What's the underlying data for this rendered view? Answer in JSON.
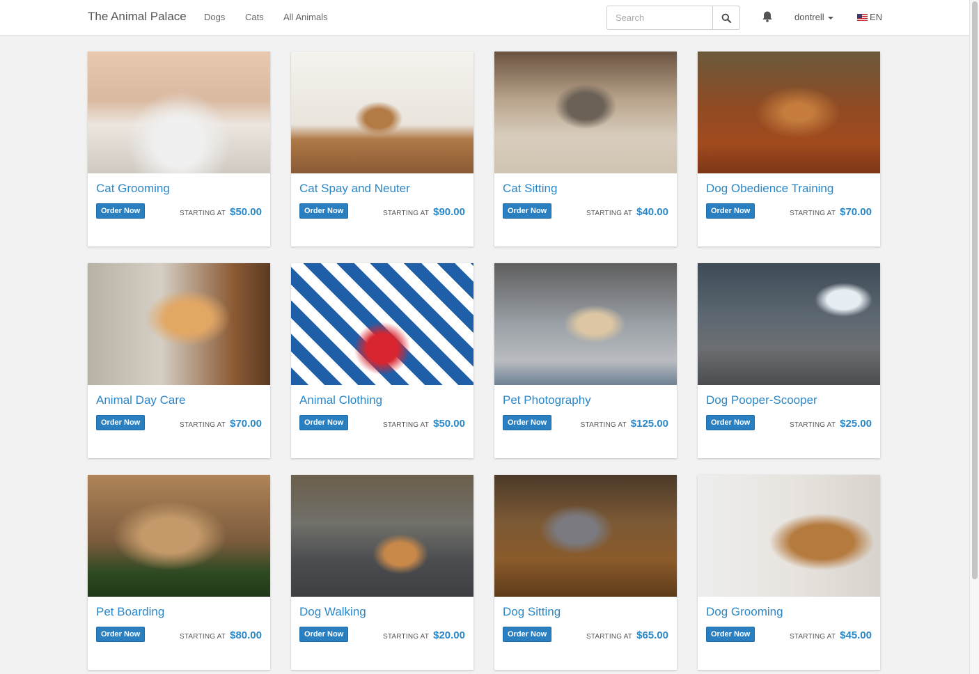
{
  "navbar": {
    "brand": "The Animal Palace",
    "links": [
      "Dogs",
      "Cats",
      "All Animals"
    ],
    "search_placeholder": "Search",
    "user": "dontrell",
    "language": "EN"
  },
  "cards": [
    {
      "title": "Cat Grooming",
      "button": "Order Now",
      "starting_label": "STARTING AT",
      "price": "$50.00"
    },
    {
      "title": "Cat Spay and Neuter",
      "button": "Order Now",
      "starting_label": "STARTING AT",
      "price": "$90.00"
    },
    {
      "title": "Cat Sitting",
      "button": "Order Now",
      "starting_label": "STARTING AT",
      "price": "$40.00"
    },
    {
      "title": "Dog Obedience Training",
      "button": "Order Now",
      "starting_label": "STARTING AT",
      "price": "$70.00"
    },
    {
      "title": "Animal Day Care",
      "button": "Order Now",
      "starting_label": "STARTING AT",
      "price": "$70.00"
    },
    {
      "title": "Animal Clothing",
      "button": "Order Now",
      "starting_label": "STARTING AT",
      "price": "$50.00"
    },
    {
      "title": "Pet Photography",
      "button": "Order Now",
      "starting_label": "STARTING AT",
      "price": "$125.00"
    },
    {
      "title": "Dog Pooper-Scooper",
      "button": "Order Now",
      "starting_label": "STARTING AT",
      "price": "$25.00"
    },
    {
      "title": "Pet Boarding",
      "button": "Order Now",
      "starting_label": "STARTING AT",
      "price": "$80.00"
    },
    {
      "title": "Dog Walking",
      "button": "Order Now",
      "starting_label": "STARTING AT",
      "price": "$20.00"
    },
    {
      "title": "Dog Sitting",
      "button": "Order Now",
      "starting_label": "STARTING AT",
      "price": "$65.00"
    },
    {
      "title": "Dog Grooming",
      "button": "Order Now",
      "starting_label": "STARTING AT",
      "price": "$45.00"
    }
  ],
  "colors": {
    "accent": "#2a87c8",
    "button": "#2a7fc1",
    "background": "#f2f2f2"
  }
}
